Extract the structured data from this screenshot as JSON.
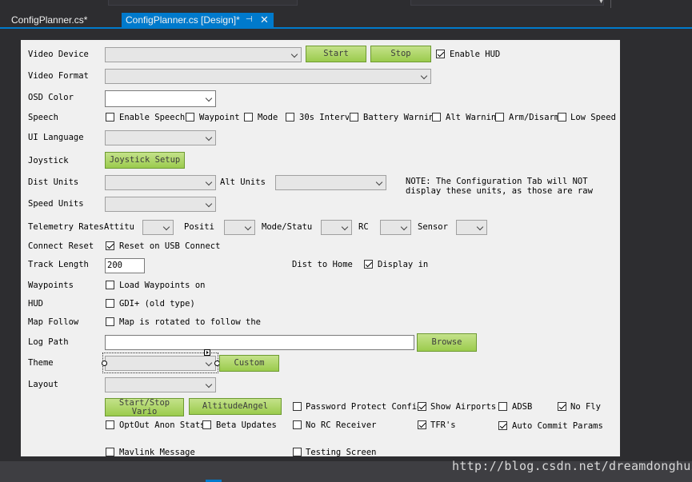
{
  "tabs": [
    {
      "label": "ConfigPlanner.cs*",
      "active": false
    },
    {
      "label": "ConfigPlanner.cs [Design]*",
      "active": true
    }
  ],
  "icons": {
    "pin": "pin-icon",
    "close": "close-icon"
  },
  "accent_color": "#007acc",
  "button_color": "#a8d35a",
  "form": {
    "video_device": {
      "label": "Video Device",
      "start": "Start",
      "stop": "Stop",
      "enable_hud": "Enable HUD",
      "enable_hud_checked": true
    },
    "video_format": {
      "label": "Video Format"
    },
    "osd_color": {
      "label": "OSD Color"
    },
    "speech": {
      "label": "Speech",
      "options": [
        "Enable Speech",
        "Waypoint",
        "Mode",
        "30s Interv",
        "Battery Warnin",
        "Alt Warnin",
        "Arm/Disarm",
        "Low Speed"
      ]
    },
    "ui_language": {
      "label": "UI Language"
    },
    "joystick": {
      "label": "Joystick",
      "button": "Joystick Setup"
    },
    "dist_units": {
      "label": "Dist Units",
      "alt_units": "Alt Units",
      "note_line1": "NOTE: The Configuration Tab will NOT",
      "note_line2": "display these units, as those are raw"
    },
    "speed_units": {
      "label": "Speed Units"
    },
    "telemetry": {
      "label": "Telemetry Rates",
      "fields": [
        "Attitu",
        "Positi",
        "Mode/Statu",
        "RC",
        "Sensor"
      ]
    },
    "connect_reset": {
      "label": "Connect Reset",
      "checkbox": "Reset on USB Connect",
      "checked": true
    },
    "track_length": {
      "label": "Track Length",
      "value": "200",
      "dist_to_home": "Dist to Home",
      "display_in": "Display in",
      "display_in_checked": true
    },
    "waypoints": {
      "label": "Waypoints",
      "checkbox": "Load Waypoints on"
    },
    "hud": {
      "label": "HUD",
      "checkbox": "GDI+ (old type)"
    },
    "map_follow": {
      "label": "Map Follow",
      "checkbox": "Map is rotated to follow the"
    },
    "log_path": {
      "label": "Log Path",
      "value": "",
      "browse": "Browse"
    },
    "theme": {
      "label": "Theme",
      "custom": "Custom"
    },
    "layout": {
      "label": "Layout"
    },
    "bottom_buttons": {
      "start_stop_line1": "Start/Stop",
      "start_stop_line2": "Vario",
      "altitude_angel": "AltitudeAngel"
    },
    "options": {
      "password_protect": "Password Protect Config",
      "show_airports": "Show Airports",
      "adsb": "ADSB",
      "no_fly": "No Fly",
      "optout": "OptOut Anon Stats",
      "beta_updates": "Beta Updates",
      "no_rc_receiver": "No RC Receiver",
      "tfrs": "TFR's",
      "auto_commit": "Auto Commit Params",
      "mavlink_message": "Mavlink Message",
      "testing_screen": "Testing Screen"
    }
  },
  "watermark": "http://blog.csdn.net/dreamdonghui"
}
